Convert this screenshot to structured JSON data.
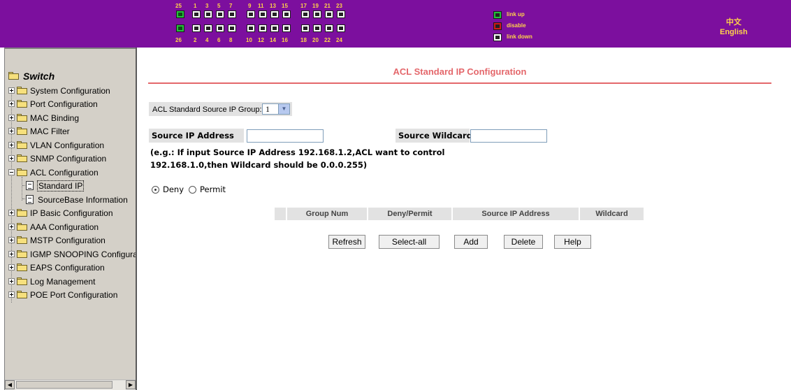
{
  "ports": {
    "top_numbers": [
      "25",
      "1",
      "3",
      "5",
      "7",
      "9",
      "11",
      "13",
      "15",
      "17",
      "19",
      "21",
      "23"
    ],
    "bottom_numbers": [
      "26",
      "2",
      "4",
      "6",
      "8",
      "10",
      "12",
      "14",
      "16",
      "18",
      "20",
      "22",
      "24"
    ],
    "link_up_ports": [
      "25",
      "26"
    ]
  },
  "legend": {
    "link_up": "link up",
    "disable": "disable",
    "link_down": "link down",
    "colors": {
      "link_up": "#25c13c",
      "disable": "#d11a1a",
      "link_down": "#ffffff"
    }
  },
  "language": {
    "chinese": "中文",
    "english": "English"
  },
  "sidebar": {
    "root": "Switch",
    "items": [
      {
        "label": "System Configuration"
      },
      {
        "label": "Port Configuration"
      },
      {
        "label": "MAC Binding"
      },
      {
        "label": "MAC Filter"
      },
      {
        "label": "VLAN Configuration"
      },
      {
        "label": "SNMP Configuration"
      },
      {
        "label": "ACL Configuration"
      },
      {
        "label": "Standard IP"
      },
      {
        "label": "SourceBase Information"
      },
      {
        "label": "IP Basic Configuration"
      },
      {
        "label": "AAA Configuration"
      },
      {
        "label": "MSTP Configuration"
      },
      {
        "label": "IGMP SNOOPING Configura"
      },
      {
        "label": "EAPS Configuration"
      },
      {
        "label": "Log Management"
      },
      {
        "label": "POE Port Configuration"
      }
    ]
  },
  "main": {
    "title": "ACL Standard IP Configuration",
    "group_label": "ACL Standard Source IP Group:",
    "group_value": "1",
    "source_ip_label": "Source IP Address",
    "source_ip_value": "",
    "wildcard_label": "Source Wildcard:",
    "wildcard_value": "",
    "note_line1": "(e.g.: If input Source IP Address 192.168.1.2,ACL want to control",
    "note_line2": "192.168.1.0,then Wildcard should be 0.0.0.255)",
    "radio_deny": "Deny",
    "radio_permit": "Permit",
    "selected_action": "Deny",
    "table_headers": [
      "",
      "Group Num",
      "Deny/Permit",
      "Source IP Address",
      "Wildcard"
    ],
    "buttons": {
      "refresh": "Refresh",
      "select_all": "Select-all",
      "add": "Add",
      "delete": "Delete",
      "help": "Help"
    }
  },
  "colors": {
    "banner": "#7c0f9e",
    "banner_text": "#ffd24a",
    "title": "#e4676b",
    "sidebar": "#d4d0c8"
  }
}
